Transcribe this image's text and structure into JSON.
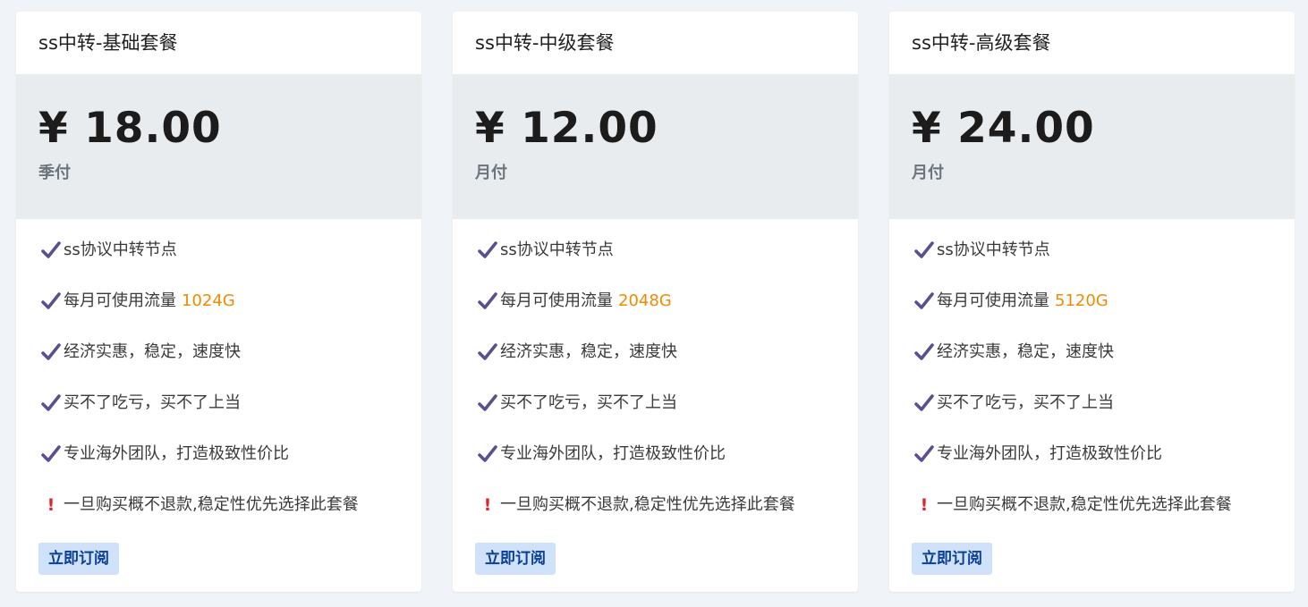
{
  "colors": {
    "background": "#f0f3f7",
    "card": "#ffffff",
    "price_band": "#e9ecef",
    "check": "#5b4f8f",
    "highlight": "#f08a00",
    "warning": "#e0242a",
    "button_bg": "#cfe2fa",
    "button_text": "#0b3f94"
  },
  "plans": [
    {
      "title": "ss中转-基础套餐",
      "price": "¥ 18.00",
      "period": "季付",
      "features": [
        "ss协议中转节点",
        "每月可使用流量",
        "经济实惠，稳定，速度快",
        "买不了吃亏，买不了上当",
        "专业海外团队，打造极致性价比"
      ],
      "traffic": "1024G",
      "warning": "一旦购买概不退款,稳定性优先选择此套餐",
      "button": "立即订阅"
    },
    {
      "title": "ss中转-中级套餐",
      "price": "¥ 12.00",
      "period": "月付",
      "features": [
        "ss协议中转节点",
        "每月可使用流量",
        "经济实惠，稳定，速度快",
        "买不了吃亏，买不了上当",
        "专业海外团队，打造极致性价比"
      ],
      "traffic": "2048G",
      "warning": "一旦购买概不退款,稳定性优先选择此套餐",
      "button": "立即订阅"
    },
    {
      "title": "ss中转-高级套餐",
      "price": "¥ 24.00",
      "period": "月付",
      "features": [
        "ss协议中转节点",
        "每月可使用流量",
        "经济实惠，稳定，速度快",
        "买不了吃亏，买不了上当",
        "专业海外团队，打造极致性价比"
      ],
      "traffic": "5120G",
      "warning": "一旦购买概不退款,稳定性优先选择此套餐",
      "button": "立即订阅"
    }
  ]
}
